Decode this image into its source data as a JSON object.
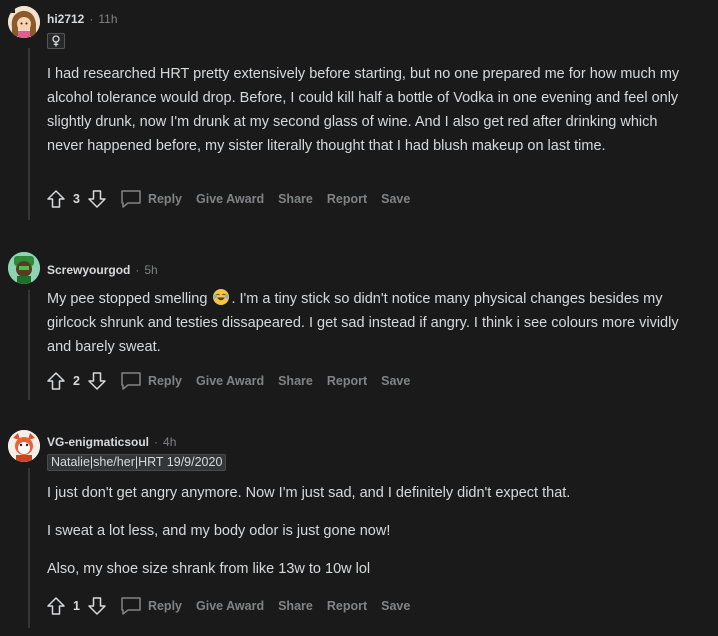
{
  "comments": [
    {
      "author": "hi2712",
      "time": "11h",
      "dot": "·",
      "flair_icon": "female-symbol-icon",
      "body": [
        "I had researched HRT pretty extensively before starting, but no one prepared me for how much my alcohol tolerance would drop. Before, I could kill half a bottle of Vodka in one evening and feel only slightly drunk, now I'm drunk at my second glass of wine. And I also get red after drinking which never happened before, my sister literally thought that I had blush makeup on last time."
      ],
      "score": "3"
    },
    {
      "author": "Screwyourgod",
      "time": "5h",
      "dot": "·",
      "body_before_emoji": "My pee stopped smelling",
      "emoji": "laughing-crying-emoji-icon",
      "body_after_emoji": ". I'm a tiny stick so didn't notice many physical changes besides my girlcock shrunk and testies dissapeared. I get sad instead if angry. I think i see colours more vividly and barely sweat.",
      "score": "2"
    },
    {
      "author": "VG-enigmaticsoul",
      "time": "4h",
      "dot": "·",
      "flair_text": "Natalie|she/her|HRT 19/9/2020",
      "body": [
        "I just don't get angry anymore. Now I'm just sad, and I definitely didn't expect that.",
        "I sweat a lot less, and my body odor is just gone now!",
        "Also, my shoe size shrank from like 13w to 10w lol"
      ],
      "score": "1"
    }
  ],
  "actions": {
    "reply": "Reply",
    "give_award": "Give Award",
    "share": "Share",
    "report": "Report",
    "save": "Save"
  },
  "colors": {
    "background": "#1a1a1b",
    "text": "#d7dadc",
    "muted": "#818384",
    "thread_line": "#343536"
  }
}
